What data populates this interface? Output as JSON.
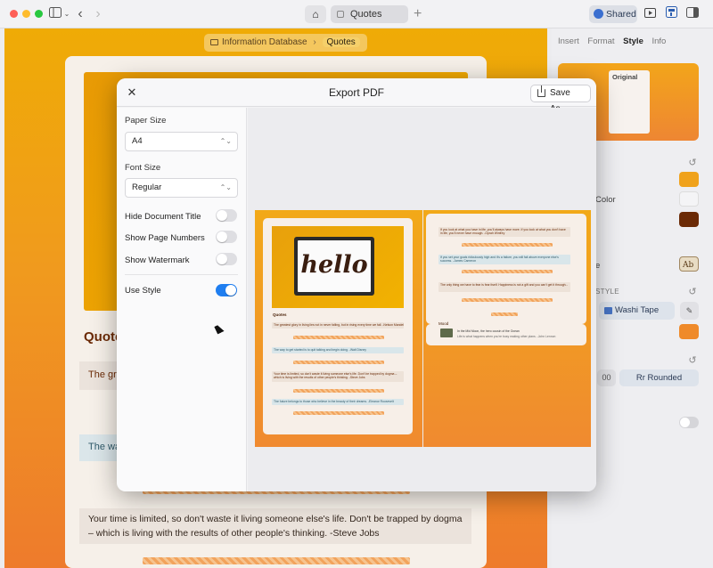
{
  "toolbar": {
    "tab_title": "Quotes",
    "shared_label": "Shared"
  },
  "breadcrumb": {
    "parent": "Information Database",
    "separator": "›",
    "current": "Quotes"
  },
  "document": {
    "heading": "Quote",
    "quote1": "The gre",
    "quote2": "The way",
    "quote3": "Your time is limited, so don't waste it living someone else's life. Don't be trapped by dogma – which is living with the results of other people's thinking. -Steve Jobs"
  },
  "inspector": {
    "tabs": [
      {
        "label": "Insert"
      },
      {
        "label": "Format"
      },
      {
        "label": "Style"
      },
      {
        "label": "Info"
      }
    ],
    "active_tab": "Style",
    "preview_label": "Original",
    "color_label": "Color",
    "e_label": "e",
    "style_section": "STYLE",
    "washi_label": "Washi Tape",
    "radius_label": "00",
    "rounded_label": "Rounded",
    "rounded_prefix": "Rr",
    "colors": {
      "swatch1": "#f0a21c",
      "swatch2": "#f4f4f6",
      "swatch3": "#6b2a06",
      "swatch4": "#ef8a2a"
    }
  },
  "dialog": {
    "title": "Export PDF",
    "save_as": "Save As...",
    "paper_size_label": "Paper Size",
    "paper_size_value": "A4",
    "font_size_label": "Font Size",
    "font_size_value": "Regular",
    "toggles": [
      {
        "label": "Hide Document Title",
        "on": false
      },
      {
        "label": "Show Page Numbers",
        "on": false
      },
      {
        "label": "Show Watermark",
        "on": false
      },
      {
        "label": "Use Style",
        "on": true
      }
    ],
    "preview": {
      "image_text": "hello",
      "page1_heading": "Quotes",
      "page1_quotes": [
        "The greatest glory in living lies not in never falling, but in rising every time we fall. -Nelson Mandela",
        "The way to get started is to quit talking and begin doing. -Walt Disney",
        "Your time is limited, so don't waste it living someone else's life. Don't be trapped by dogma – which is living with the results of other people's thinking. -Steve Jobs",
        "The future belongs to those who believe in the beauty of their dreams. -Eleanor Roosevelt"
      ],
      "page2_quotes": [
        "If you look at what you have in life, you'll always have more. If you look at what you don't have in life, you'll never have enough. -Oprah Winfrey",
        "If you set your goals ridiculously high and it's a failure, you will fail above everyone else's success. -James Cameron",
        "The only thing we have to fear is fear itself. Happiness is not a gift and you can't get it through...",
        "Life is what happens when you're busy making other plans. -John Lennon"
      ],
      "page2_section": "Mood",
      "page2_caption": "In the Mid Moon, the hero cousin of the Ocean"
    }
  }
}
